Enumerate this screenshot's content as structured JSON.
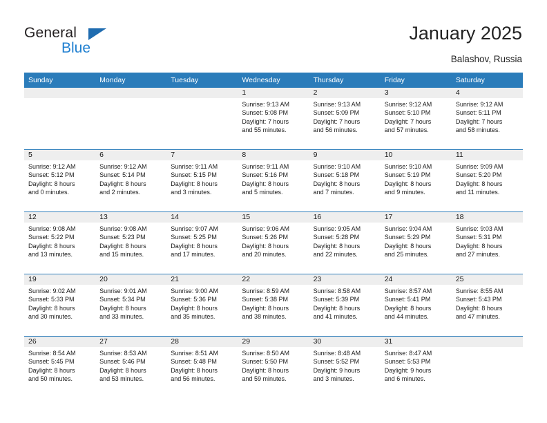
{
  "brand": {
    "name_top": "General",
    "name_bottom": "Blue",
    "accent_color": "#2b7cba"
  },
  "header": {
    "title": "January 2025",
    "subtitle": "Balashov, Russia"
  },
  "calendar": {
    "weekdays": [
      "Sunday",
      "Monday",
      "Tuesday",
      "Wednesday",
      "Thursday",
      "Friday",
      "Saturday"
    ],
    "labels": {
      "sunrise": "Sunrise:",
      "sunset": "Sunset:",
      "daylight": "Daylight:"
    },
    "weeks": [
      [
        {
          "day": "",
          "sunrise": "",
          "sunset": "",
          "daylight_line1": "",
          "daylight_line2": ""
        },
        {
          "day": "",
          "sunrise": "",
          "sunset": "",
          "daylight_line1": "",
          "daylight_line2": ""
        },
        {
          "day": "",
          "sunrise": "",
          "sunset": "",
          "daylight_line1": "",
          "daylight_line2": ""
        },
        {
          "day": "1",
          "sunrise": "Sunrise: 9:13 AM",
          "sunset": "Sunset: 5:08 PM",
          "daylight_line1": "Daylight: 7 hours",
          "daylight_line2": "and 55 minutes."
        },
        {
          "day": "2",
          "sunrise": "Sunrise: 9:13 AM",
          "sunset": "Sunset: 5:09 PM",
          "daylight_line1": "Daylight: 7 hours",
          "daylight_line2": "and 56 minutes."
        },
        {
          "day": "3",
          "sunrise": "Sunrise: 9:12 AM",
          "sunset": "Sunset: 5:10 PM",
          "daylight_line1": "Daylight: 7 hours",
          "daylight_line2": "and 57 minutes."
        },
        {
          "day": "4",
          "sunrise": "Sunrise: 9:12 AM",
          "sunset": "Sunset: 5:11 PM",
          "daylight_line1": "Daylight: 7 hours",
          "daylight_line2": "and 58 minutes."
        }
      ],
      [
        {
          "day": "5",
          "sunrise": "Sunrise: 9:12 AM",
          "sunset": "Sunset: 5:12 PM",
          "daylight_line1": "Daylight: 8 hours",
          "daylight_line2": "and 0 minutes."
        },
        {
          "day": "6",
          "sunrise": "Sunrise: 9:12 AM",
          "sunset": "Sunset: 5:14 PM",
          "daylight_line1": "Daylight: 8 hours",
          "daylight_line2": "and 2 minutes."
        },
        {
          "day": "7",
          "sunrise": "Sunrise: 9:11 AM",
          "sunset": "Sunset: 5:15 PM",
          "daylight_line1": "Daylight: 8 hours",
          "daylight_line2": "and 3 minutes."
        },
        {
          "day": "8",
          "sunrise": "Sunrise: 9:11 AM",
          "sunset": "Sunset: 5:16 PM",
          "daylight_line1": "Daylight: 8 hours",
          "daylight_line2": "and 5 minutes."
        },
        {
          "day": "9",
          "sunrise": "Sunrise: 9:10 AM",
          "sunset": "Sunset: 5:18 PM",
          "daylight_line1": "Daylight: 8 hours",
          "daylight_line2": "and 7 minutes."
        },
        {
          "day": "10",
          "sunrise": "Sunrise: 9:10 AM",
          "sunset": "Sunset: 5:19 PM",
          "daylight_line1": "Daylight: 8 hours",
          "daylight_line2": "and 9 minutes."
        },
        {
          "day": "11",
          "sunrise": "Sunrise: 9:09 AM",
          "sunset": "Sunset: 5:20 PM",
          "daylight_line1": "Daylight: 8 hours",
          "daylight_line2": "and 11 minutes."
        }
      ],
      [
        {
          "day": "12",
          "sunrise": "Sunrise: 9:08 AM",
          "sunset": "Sunset: 5:22 PM",
          "daylight_line1": "Daylight: 8 hours",
          "daylight_line2": "and 13 minutes."
        },
        {
          "day": "13",
          "sunrise": "Sunrise: 9:08 AM",
          "sunset": "Sunset: 5:23 PM",
          "daylight_line1": "Daylight: 8 hours",
          "daylight_line2": "and 15 minutes."
        },
        {
          "day": "14",
          "sunrise": "Sunrise: 9:07 AM",
          "sunset": "Sunset: 5:25 PM",
          "daylight_line1": "Daylight: 8 hours",
          "daylight_line2": "and 17 minutes."
        },
        {
          "day": "15",
          "sunrise": "Sunrise: 9:06 AM",
          "sunset": "Sunset: 5:26 PM",
          "daylight_line1": "Daylight: 8 hours",
          "daylight_line2": "and 20 minutes."
        },
        {
          "day": "16",
          "sunrise": "Sunrise: 9:05 AM",
          "sunset": "Sunset: 5:28 PM",
          "daylight_line1": "Daylight: 8 hours",
          "daylight_line2": "and 22 minutes."
        },
        {
          "day": "17",
          "sunrise": "Sunrise: 9:04 AM",
          "sunset": "Sunset: 5:29 PM",
          "daylight_line1": "Daylight: 8 hours",
          "daylight_line2": "and 25 minutes."
        },
        {
          "day": "18",
          "sunrise": "Sunrise: 9:03 AM",
          "sunset": "Sunset: 5:31 PM",
          "daylight_line1": "Daylight: 8 hours",
          "daylight_line2": "and 27 minutes."
        }
      ],
      [
        {
          "day": "19",
          "sunrise": "Sunrise: 9:02 AM",
          "sunset": "Sunset: 5:33 PM",
          "daylight_line1": "Daylight: 8 hours",
          "daylight_line2": "and 30 minutes."
        },
        {
          "day": "20",
          "sunrise": "Sunrise: 9:01 AM",
          "sunset": "Sunset: 5:34 PM",
          "daylight_line1": "Daylight: 8 hours",
          "daylight_line2": "and 33 minutes."
        },
        {
          "day": "21",
          "sunrise": "Sunrise: 9:00 AM",
          "sunset": "Sunset: 5:36 PM",
          "daylight_line1": "Daylight: 8 hours",
          "daylight_line2": "and 35 minutes."
        },
        {
          "day": "22",
          "sunrise": "Sunrise: 8:59 AM",
          "sunset": "Sunset: 5:38 PM",
          "daylight_line1": "Daylight: 8 hours",
          "daylight_line2": "and 38 minutes."
        },
        {
          "day": "23",
          "sunrise": "Sunrise: 8:58 AM",
          "sunset": "Sunset: 5:39 PM",
          "daylight_line1": "Daylight: 8 hours",
          "daylight_line2": "and 41 minutes."
        },
        {
          "day": "24",
          "sunrise": "Sunrise: 8:57 AM",
          "sunset": "Sunset: 5:41 PM",
          "daylight_line1": "Daylight: 8 hours",
          "daylight_line2": "and 44 minutes."
        },
        {
          "day": "25",
          "sunrise": "Sunrise: 8:55 AM",
          "sunset": "Sunset: 5:43 PM",
          "daylight_line1": "Daylight: 8 hours",
          "daylight_line2": "and 47 minutes."
        }
      ],
      [
        {
          "day": "26",
          "sunrise": "Sunrise: 8:54 AM",
          "sunset": "Sunset: 5:45 PM",
          "daylight_line1": "Daylight: 8 hours",
          "daylight_line2": "and 50 minutes."
        },
        {
          "day": "27",
          "sunrise": "Sunrise: 8:53 AM",
          "sunset": "Sunset: 5:46 PM",
          "daylight_line1": "Daylight: 8 hours",
          "daylight_line2": "and 53 minutes."
        },
        {
          "day": "28",
          "sunrise": "Sunrise: 8:51 AM",
          "sunset": "Sunset: 5:48 PM",
          "daylight_line1": "Daylight: 8 hours",
          "daylight_line2": "and 56 minutes."
        },
        {
          "day": "29",
          "sunrise": "Sunrise: 8:50 AM",
          "sunset": "Sunset: 5:50 PM",
          "daylight_line1": "Daylight: 8 hours",
          "daylight_line2": "and 59 minutes."
        },
        {
          "day": "30",
          "sunrise": "Sunrise: 8:48 AM",
          "sunset": "Sunset: 5:52 PM",
          "daylight_line1": "Daylight: 9 hours",
          "daylight_line2": "and 3 minutes."
        },
        {
          "day": "31",
          "sunrise": "Sunrise: 8:47 AM",
          "sunset": "Sunset: 5:53 PM",
          "daylight_line1": "Daylight: 9 hours",
          "daylight_line2": "and 6 minutes."
        },
        {
          "day": "",
          "sunrise": "",
          "sunset": "",
          "daylight_line1": "",
          "daylight_line2": ""
        }
      ]
    ]
  }
}
